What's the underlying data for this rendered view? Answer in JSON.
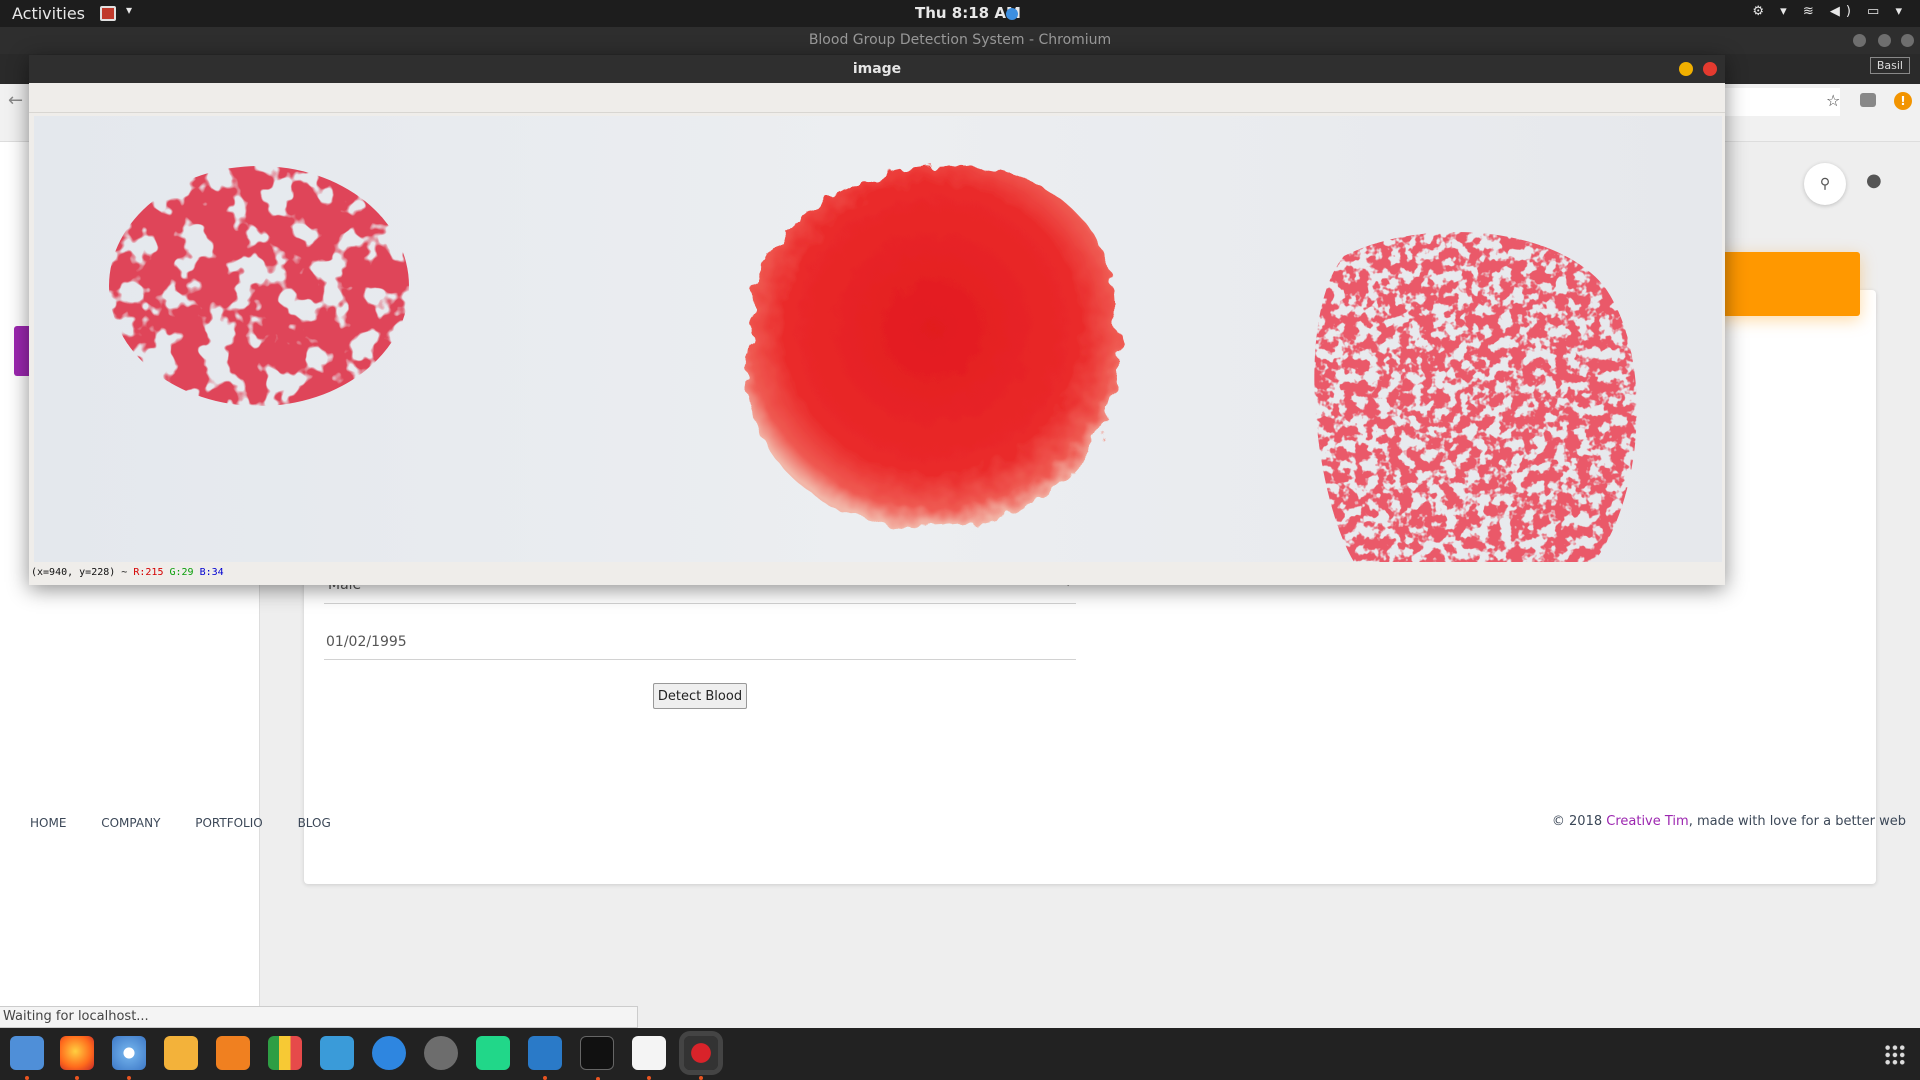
{
  "topbar": {
    "activities": "Activities",
    "clock": "Thu  8:18 AM",
    "tray": "⚙ ▾ ≋ ◀) ▭ ▾"
  },
  "chrome": {
    "window_title": "Blood Group Detection System - Chromium",
    "user_badge": "Basil"
  },
  "page": {
    "gender_value": "Male",
    "dob_value": "01/02/1995",
    "detect_button": "Detect Blood",
    "footer_nav": [
      "HOME",
      "COMPANY",
      "PORTFOLIO",
      "BLOG"
    ],
    "footer_copy_prefix": "© 2018 ",
    "footer_copy_link": "Creative Tim",
    "footer_copy_suffix": ", made with love for a better web",
    "status_text": "Waiting for localhost..."
  },
  "cv_window": {
    "title": "image",
    "status_coords": "(x=940, y=228) ~ ",
    "status_r": "R:215",
    "status_g": "G:29",
    "status_b": "B:34"
  },
  "colors": {
    "accent_purple": "#9c27b0",
    "card_header_orange": "#ff9800",
    "blood_red": "#d71d22"
  },
  "dock": {
    "apps": [
      "finder-icon",
      "firefox-icon",
      "chromium-icon",
      "notes-icon",
      "vlc-icon",
      "spreadsheet-icon",
      "window-icon",
      "app-store-icon",
      "settings-icon",
      "pycharm-icon",
      "vscode-icon",
      "terminal-icon",
      "text-editor-icon",
      "recorder-icon"
    ]
  }
}
